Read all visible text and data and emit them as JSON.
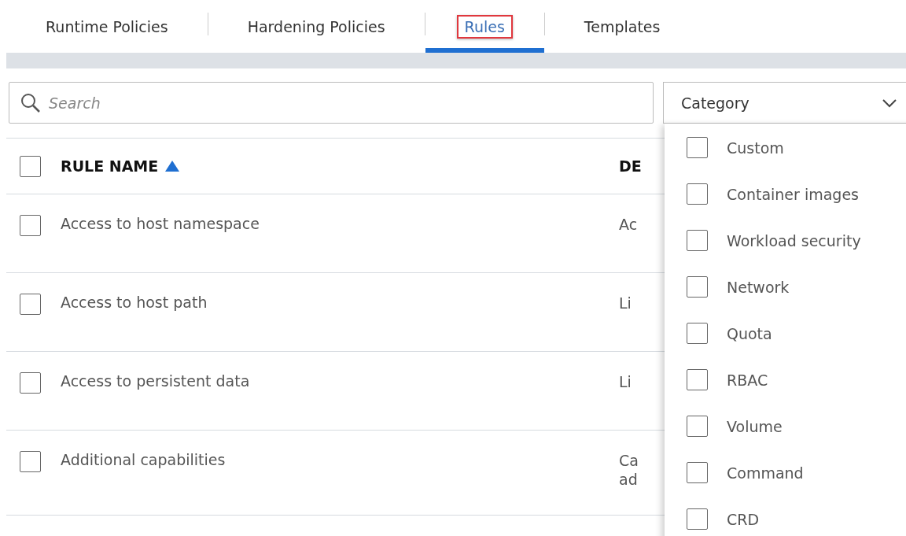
{
  "tabs": [
    {
      "label": "Runtime Policies",
      "selected": false,
      "highlighted": false
    },
    {
      "label": "Hardening Policies",
      "selected": false,
      "highlighted": false
    },
    {
      "label": "Rules",
      "selected": true,
      "highlighted": true
    },
    {
      "label": "Templates",
      "selected": false,
      "highlighted": false
    }
  ],
  "search": {
    "placeholder": "Search"
  },
  "category_select": {
    "label": "Category",
    "expanded": true,
    "options": [
      {
        "label": "Custom",
        "checked": false
      },
      {
        "label": "Container images",
        "checked": false
      },
      {
        "label": "Workload security",
        "checked": false
      },
      {
        "label": "Network",
        "checked": false
      },
      {
        "label": "Quota",
        "checked": false
      },
      {
        "label": "RBAC",
        "checked": false
      },
      {
        "label": "Volume",
        "checked": false
      },
      {
        "label": "Command",
        "checked": false
      },
      {
        "label": "CRD",
        "checked": false
      }
    ]
  },
  "table": {
    "select_all_checked": false,
    "columns": [
      {
        "label": "RULE NAME",
        "sort_ascending": true
      },
      {
        "label": "DE"
      }
    ],
    "rows": [
      {
        "checked": false,
        "name": "Access to host namespace",
        "description": [
          "Ac"
        ]
      },
      {
        "checked": false,
        "name": "Access to host path",
        "description": [
          "Li"
        ]
      },
      {
        "checked": false,
        "name": "Access to persistent data",
        "description": [
          "Li"
        ]
      },
      {
        "checked": false,
        "name": "Additional capabilities",
        "description": [
          "Ca",
          "ad"
        ]
      }
    ]
  }
}
